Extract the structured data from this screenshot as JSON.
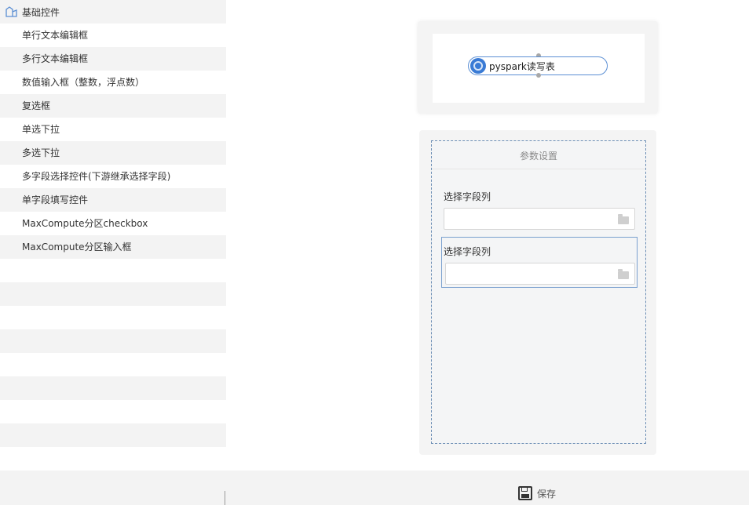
{
  "sidebar": {
    "section_title": "基础控件",
    "items": [
      {
        "label": "单行文本编辑框"
      },
      {
        "label": "多行文本编辑框"
      },
      {
        "label": "数值输入框（整数，浮点数）"
      },
      {
        "label": "复选框"
      },
      {
        "label": "单选下拉"
      },
      {
        "label": "多选下拉"
      },
      {
        "label": "多字段选择控件(下游继承选择字段)"
      },
      {
        "label": "单字段填写控件"
      },
      {
        "label": "MaxCompute分区checkbox"
      },
      {
        "label": "MaxCompute分区输入框"
      }
    ]
  },
  "canvas": {
    "node": {
      "label": "pyspark读写表",
      "icon": "node-circle-icon"
    },
    "params": {
      "title": "参数设置",
      "fields": [
        {
          "label": "选择字段列",
          "value": "",
          "icon": "folder-icon"
        },
        {
          "label": "选择字段列",
          "value": "",
          "icon": "folder-icon"
        }
      ]
    }
  },
  "footer": {
    "save_label": "保存",
    "save_icon": "save-icon"
  },
  "colors": {
    "accent": "#3a7bd5",
    "stripe": "#f3f3f3",
    "dashed_border": "#6d8fb5"
  }
}
